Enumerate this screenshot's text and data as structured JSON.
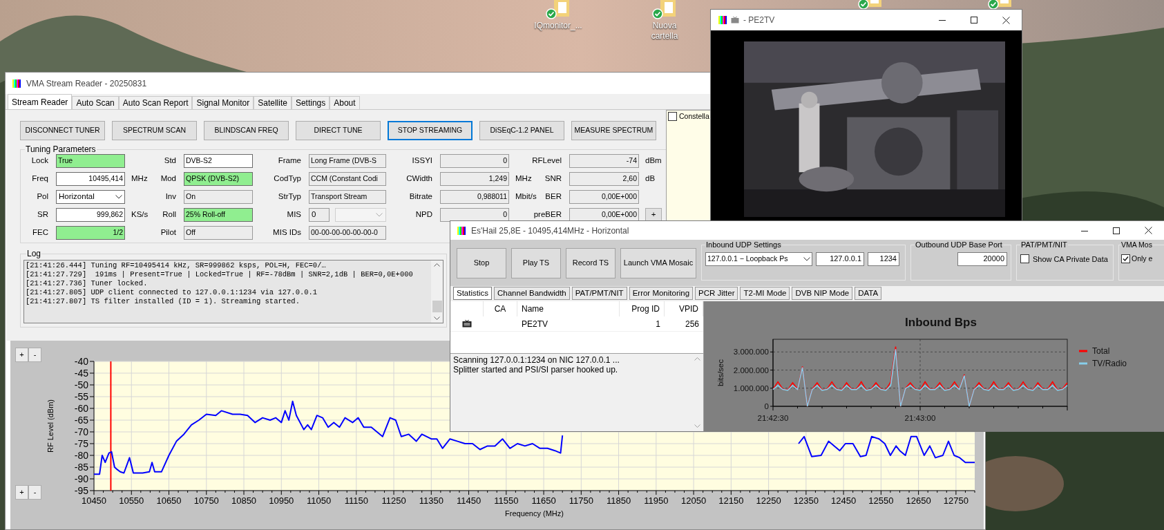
{
  "desktop": {
    "icons": [
      {
        "label": "IQmonitor_..."
      },
      {
        "label": "Nuova cartella"
      }
    ]
  },
  "main_window": {
    "title": "VMA Stream Reader - 20250831",
    "tabs": [
      {
        "label": "Stream Reader",
        "selected": true
      },
      {
        "label": "Auto Scan",
        "selected": false
      },
      {
        "label": "Auto Scan Report",
        "selected": false
      },
      {
        "label": "Signal Monitor",
        "selected": false
      },
      {
        "label": "Satellite",
        "selected": false
      },
      {
        "label": "Settings",
        "selected": false
      },
      {
        "label": "About",
        "selected": false
      }
    ],
    "buttons": [
      {
        "label": "DISCONNECT TUNER",
        "focused": false
      },
      {
        "label": "SPECTRUM SCAN",
        "focused": false
      },
      {
        "label": "BLINDSCAN FREQ",
        "focused": false
      },
      {
        "label": "DIRECT TUNE",
        "focused": false
      },
      {
        "label": "STOP STREAMING",
        "focused": true
      },
      {
        "label": "DiSEqC-1.2 PANEL",
        "focused": false
      },
      {
        "label": "MEASURE SPECTRUM",
        "focused": false
      }
    ],
    "constellation": {
      "label": "Constella",
      "checked": false
    },
    "tuning": {
      "title": "Tuning Parameters",
      "rows": [
        [
          {
            "label": "Lock",
            "value": "True",
            "kind": "text",
            "readonly": false,
            "highlighted": true
          },
          {
            "label": "Std",
            "value": "DVB-S2",
            "kind": "text",
            "readonly": false,
            "highlighted": false
          },
          {
            "label": "Frame",
            "value": "Long Frame (DVB-S",
            "kind": "text",
            "readonly": true,
            "highlighted": false
          },
          {
            "label": "ISSYI",
            "value": "0",
            "kind": "number",
            "readonly": true,
            "highlighted": false
          },
          {
            "label": "RFLevel",
            "value": "-74",
            "kind": "number",
            "readonly": true,
            "highlighted": false,
            "unit": "dBm"
          }
        ],
        [
          {
            "label": "Freq",
            "value": "10495,414",
            "kind": "number",
            "readonly": false,
            "highlighted": false,
            "unit": "MHz"
          },
          {
            "label": "Mod",
            "value": "QPSK (DVB-S2)",
            "kind": "text",
            "readonly": false,
            "highlighted": true
          },
          {
            "label": "CodTyp",
            "value": "CCM (Constant Codi",
            "kind": "text",
            "readonly": true,
            "highlighted": false
          },
          {
            "label": "CWidth",
            "value": "1,249",
            "kind": "number",
            "readonly": true,
            "highlighted": false,
            "unit": "MHz"
          },
          {
            "label": "SNR",
            "value": "2,60",
            "kind": "number",
            "readonly": true,
            "highlighted": false,
            "unit": "dB"
          }
        ],
        [
          {
            "label": "Pol",
            "value": "Horizontal",
            "kind": "dropdown",
            "readonly": false,
            "highlighted": false
          },
          {
            "label": "Inv",
            "value": "On",
            "kind": "text",
            "readonly": true,
            "highlighted": false
          },
          {
            "label": "StrTyp",
            "value": "Transport Stream",
            "kind": "text",
            "readonly": true,
            "highlighted": false
          },
          {
            "label": "Bitrate",
            "value": "0,988011",
            "kind": "number",
            "readonly": true,
            "highlighted": false,
            "unit": "Mbit/s"
          },
          {
            "label": "BER",
            "value": "0,00E+000",
            "kind": "number",
            "readonly": true,
            "highlighted": false
          }
        ],
        [
          {
            "label": "SR",
            "value": "999,862",
            "kind": "number",
            "readonly": false,
            "highlighted": false,
            "unit": "KS/s"
          },
          {
            "label": "Roll",
            "value": "25% Roll-off",
            "kind": "text",
            "readonly": false,
            "highlighted": true
          },
          {
            "label": "MIS",
            "value": "0",
            "kind": "mis",
            "readonly": true,
            "highlighted": false
          },
          {
            "label": "NPD",
            "value": "0",
            "kind": "number",
            "readonly": true,
            "highlighted": false
          },
          {
            "label": "preBER",
            "value": "0,00E+000",
            "kind": "number",
            "readonly": true,
            "highlighted": false,
            "button": "+"
          }
        ],
        [
          {
            "label": "FEC",
            "value": "1/2",
            "kind": "number",
            "readonly": false,
            "highlighted": true
          },
          {
            "label": "Pilot",
            "value": "Off",
            "kind": "text",
            "readonly": true,
            "highlighted": false
          },
          {
            "label": "MIS IDs",
            "value": "00-00-00-00-00-00-0",
            "kind": "text",
            "readonly": true,
            "highlighted": false
          }
        ]
      ]
    },
    "log": {
      "title": "Log",
      "lines": [
        "[21:41:26.444] Tuning RF=10495414 kHz, SR=999862 ksps, POL=H, FEC=0/…",
        "[21:41:27.729]  191ms | Present=True | Locked=True | RF=-78dBm | SNR=2,1dB | BER=0,0E+000",
        "[21:41:27.736] Tuner locked.",
        "[21:41:27.805] UDP client connected to 127.0.0.1:1234 via 127.0.0.1",
        "[21:41:27.807] TS filter installed (ID = 1). Streaming started."
      ]
    },
    "spectrum": {
      "zoom_buttons": [
        "+",
        "-",
        "+",
        "-"
      ],
      "chart_data": {
        "type": "line",
        "xlabel": "Frequency (MHz)",
        "ylabel": "RF Level (dBm)",
        "x": [
          10450,
          10465,
          10472,
          10480,
          10490,
          10497,
          10505,
          10512,
          10520,
          10530,
          10545,
          10555,
          10580,
          10598,
          10605,
          10612,
          10630,
          10650,
          10670,
          10690,
          10710,
          10730,
          10750,
          10775,
          10790,
          10820,
          10840,
          10860,
          10880,
          10900,
          10920,
          10935,
          10950,
          10960,
          10970,
          10980,
          10990,
          11010,
          11020,
          11030,
          11045,
          11060,
          11075,
          11090,
          11105,
          11120,
          11140,
          11155,
          11170,
          11190,
          11220,
          11240,
          11255,
          11270,
          11290,
          11310,
          11325,
          11350,
          11365,
          11380,
          11400,
          11420,
          11440,
          11460,
          11480,
          11500,
          11520,
          11540,
          11560,
          11580,
          11600,
          11620,
          11640,
          11660,
          11680,
          11695,
          11700,
          11720,
          12330,
          12345,
          12365,
          12390,
          12410,
          12440,
          12455,
          12475,
          12495,
          12510,
          12525,
          12545,
          12560,
          12575,
          12590,
          12600,
          12615,
          12630,
          12645,
          12665,
          12680,
          12695,
          12715,
          12730,
          12745,
          12760,
          12775,
          12800
        ],
        "series": [
          {
            "color": "#0000ff",
            "values": [
              -88,
              -88,
              -80,
              -83,
              -79,
              -78.5,
              -85,
              -86,
              -87,
              -87.5,
              -81,
              -87.5,
              -87.5,
              -87,
              -83,
              -87,
              -87,
              -80,
              -74,
              -71,
              -67,
              -65,
              -62.5,
              -63,
              -61,
              -62.5,
              -62.5,
              -63,
              -66,
              -64,
              -65,
              -64,
              -66,
              -61,
              -65,
              -57,
              -63,
              -69,
              -67,
              -69,
              -63,
              -64,
              -68,
              -66,
              -68,
              -64,
              -66,
              -64,
              -68,
              -68,
              -72,
              -64,
              -65,
              -72,
              -71,
              -74,
              -71,
              -73,
              -73,
              -77,
              -73,
              -74,
              -75,
              -75,
              -77.5,
              -76,
              -76,
              -73,
              -77,
              -75,
              -76,
              -75,
              -77,
              -77,
              -78,
              -79,
              -71.5,
              null,
              -75,
              -72,
              -80.5,
              -80,
              -74,
              -78,
              -75,
              -75,
              -80.5,
              -80,
              -72,
              -73,
              -75,
              -80,
              -76,
              -78,
              -80,
              -72,
              -72,
              -80,
              -76,
              -81,
              -80,
              -74,
              -80,
              -81,
              -83,
              -83
            ]
          }
        ],
        "xlim": [
          10450,
          12800
        ],
        "ylim": [
          -95,
          -40
        ],
        "xticks": [
          10450,
          10550,
          10650,
          10750,
          10850,
          10950,
          11050,
          11150,
          11250,
          11350,
          11450,
          11550,
          11650,
          11750,
          11850,
          11950,
          12050,
          12150,
          12250,
          12350,
          12450,
          12550,
          12650,
          12750
        ],
        "yticks": [
          -40,
          -45,
          -50,
          -55,
          -60,
          -65,
          -70,
          -75,
          -80,
          -85,
          -90,
          -95
        ],
        "grid": true,
        "ref_lines": [
          {
            "axis": "x",
            "value": 10495,
            "color": "#ff0000"
          }
        ]
      }
    }
  },
  "stream_window": {
    "title": "Es'Hail 25,8E - 10495,414MHz - Horizontal",
    "buttons": [
      "Stop",
      "Play TS",
      "Record TS",
      "Launch VMA Mosaic"
    ],
    "inbound_udp": {
      "title": "Inbound UDP Settings",
      "interface": "127.0.0.1 − Loopback Ps",
      "address": "127.0.0.1",
      "port": "1234"
    },
    "outbound_udp": {
      "title": "Outbound UDP Base Port",
      "port": "20000"
    },
    "pat_pmt_nit": {
      "title": "PAT/PMT/NIT",
      "checkbox": {
        "label": "Show CA Private Data",
        "checked": false
      }
    },
    "vma_mosaic": {
      "title": "VMA Mos",
      "checkbox": {
        "label": "Only e",
        "checked": true
      }
    },
    "tabs": [
      {
        "label": "Statistics",
        "selected": true
      },
      {
        "label": "Channel Bandwidth",
        "selected": false
      },
      {
        "label": "PAT/PMT/NIT",
        "selected": false
      },
      {
        "label": "Error Monitoring",
        "selected": false
      },
      {
        "label": "PCR Jitter",
        "selected": false
      },
      {
        "label": "T2-MI Mode",
        "selected": false
      },
      {
        "label": "DVB NIP Mode",
        "selected": false
      },
      {
        "label": "DATA",
        "selected": false
      }
    ],
    "table": {
      "columns": [
        "CA",
        "Name",
        "Prog ID",
        "VPID"
      ],
      "rows": [
        {
          "name": "PE2TV",
          "prog_id": "1",
          "vpid": "256"
        }
      ]
    },
    "messages": [
      "Scanning 127.0.0.1:1234 on NIC 127.0.0.1 ...",
      "Splitter started and PSI/SI parser hooked up."
    ],
    "chart_data": {
      "type": "line",
      "title": "Inbound Bps",
      "ylabel": "bits/sec",
      "categories": [
        "21:42:30",
        null,
        null,
        null,
        null,
        null,
        null,
        null,
        null,
        null,
        null,
        null,
        null,
        null,
        null,
        null,
        null,
        null,
        null,
        null,
        null,
        null,
        null,
        null,
        null,
        null,
        null,
        null,
        null,
        null,
        "21:43:00",
        null,
        null,
        null,
        null,
        null,
        null,
        null,
        null,
        null,
        null,
        null,
        null,
        null,
        null,
        null,
        null,
        null,
        null,
        null,
        null,
        null,
        null,
        null,
        null,
        null,
        null,
        null,
        null,
        null,
        null
      ],
      "series": [
        {
          "name": "Total",
          "color": "#ff0000",
          "values": [
            950000,
            1350000,
            950000,
            900000,
            1300000,
            950000,
            2200000,
            0,
            950000,
            1300000,
            900000,
            950000,
            1350000,
            950000,
            900000,
            1300000,
            950000,
            950000,
            1350000,
            900000,
            950000,
            1300000,
            950000,
            900000,
            1350000,
            3300000,
            0,
            1000000,
            1300000,
            950000,
            900000,
            1350000,
            950000,
            950000,
            1300000,
            900000,
            950000,
            1350000,
            950000,
            1750000,
            0,
            950000,
            1300000,
            950000,
            900000,
            1350000,
            950000,
            950000,
            1300000,
            900000,
            950000,
            1350000,
            950000,
            900000,
            1300000,
            950000,
            950000,
            1350000,
            900000,
            950000,
            1300000
          ]
        },
        {
          "name": "TV/Radio",
          "color": "#87ceeb",
          "values": [
            930000,
            1150000,
            930000,
            880000,
            1150000,
            930000,
            2150000,
            0,
            930000,
            1150000,
            880000,
            930000,
            1150000,
            930000,
            880000,
            1150000,
            930000,
            930000,
            1150000,
            880000,
            930000,
            1150000,
            930000,
            880000,
            1150000,
            3150000,
            0,
            980000,
            1150000,
            930000,
            880000,
            1150000,
            930000,
            930000,
            1150000,
            880000,
            930000,
            1150000,
            930000,
            1700000,
            0,
            930000,
            1150000,
            930000,
            880000,
            1150000,
            930000,
            930000,
            1150000,
            880000,
            930000,
            1150000,
            930000,
            880000,
            1150000,
            930000,
            930000,
            1150000,
            880000,
            930000,
            1150000
          ]
        }
      ],
      "ylim": [
        0,
        3700000
      ],
      "grid": true,
      "legend": "right",
      "yticks": [
        {
          "value": 0,
          "label": "0"
        },
        {
          "value": 1000000,
          "label": "1.000.000"
        },
        {
          "value": 2000000,
          "label": "2.000.000"
        },
        {
          "value": 3000000,
          "label": "3.000.000"
        }
      ]
    }
  },
  "video_window": {
    "title": "- PE2TV"
  }
}
